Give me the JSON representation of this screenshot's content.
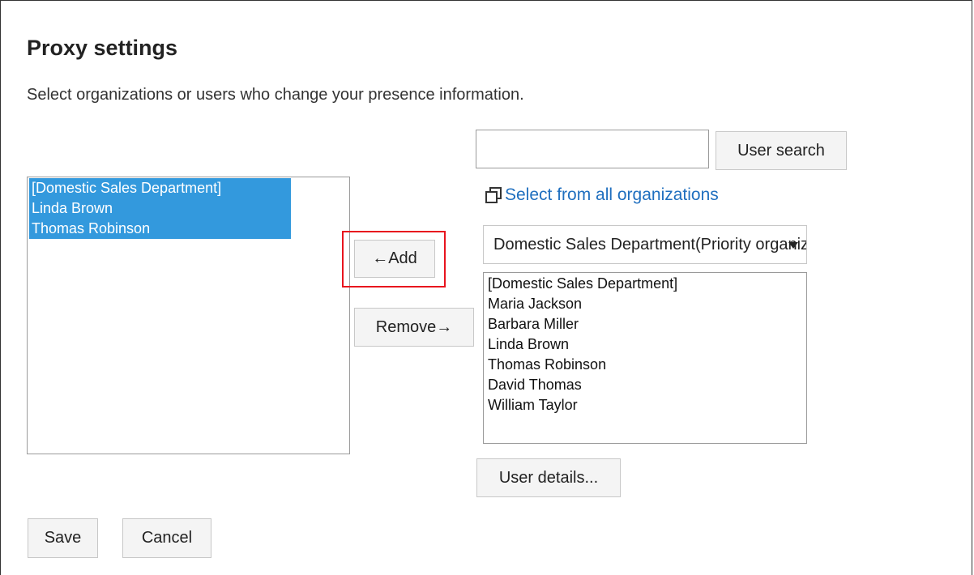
{
  "page": {
    "title": "Proxy settings",
    "description": "Select organizations or users who change your presence information."
  },
  "selected_list": {
    "items": [
      "[Domestic Sales Department]",
      "Linda Brown",
      "Thomas Robinson"
    ]
  },
  "actions": {
    "add_label": "←Add",
    "remove_label": "Remove→"
  },
  "search": {
    "value": "",
    "placeholder": "",
    "button_label": "User search"
  },
  "org_picker": {
    "link_label": "Select from all organizations",
    "selected_org": "Domestic Sales Department(Priority organization)"
  },
  "candidate_list": {
    "items": [
      "[Domestic Sales Department]",
      "Maria Jackson",
      "Barbara Miller",
      "Linda Brown",
      "Thomas Robinson",
      "David Thomas",
      "William Taylor"
    ]
  },
  "details": {
    "button_label": "User details..."
  },
  "footer": {
    "save_label": "Save",
    "cancel_label": "Cancel"
  },
  "colors": {
    "selection": "#3399dd",
    "link": "#1f6fbf",
    "highlight": "#e8141e"
  }
}
